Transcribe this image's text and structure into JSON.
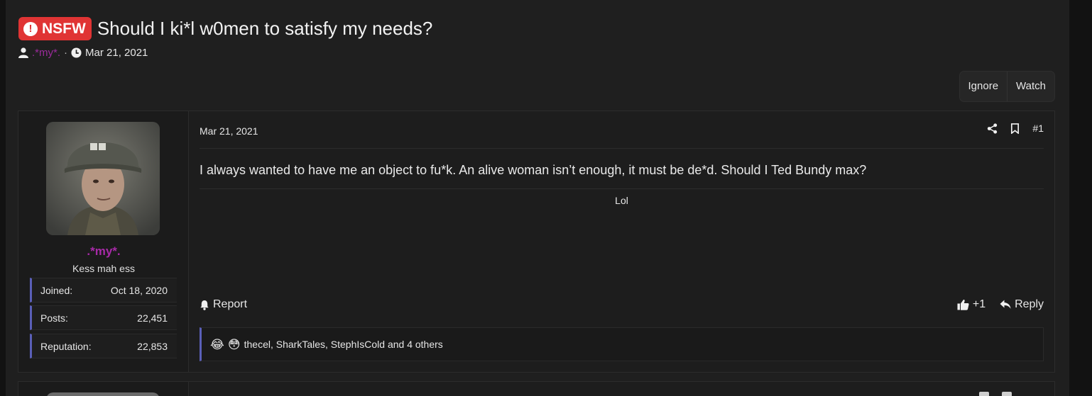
{
  "thread": {
    "badge_label": "NSFW",
    "badge_icon": "exclamation-circle-icon",
    "title": "Should I ki*l w0men to satisfy my needs?",
    "author": ".*my*.",
    "separator": "·",
    "date": "Mar 21, 2021"
  },
  "thread_buttons": {
    "ignore": "Ignore",
    "watch": "Watch"
  },
  "post": {
    "user": {
      "name": ".*my*.",
      "title": "Kess mah ess",
      "stats": [
        {
          "label": "Joined:",
          "value": "Oct 18, 2020"
        },
        {
          "label": "Posts:",
          "value": "22,451"
        },
        {
          "label": "Reputation:",
          "value": "22,853"
        }
      ]
    },
    "date": "Mar 21, 2021",
    "number": "#1",
    "body": "I always wanted to have me an object to fu*k. An alive woman isn’t enough, it must be de*d. Should I Ted Bundy max?",
    "signature": "Lol",
    "report_label": "Report",
    "like_count": "+1",
    "reply_label": "Reply",
    "reactions": {
      "emojis": [
        "😂",
        "😳"
      ],
      "text": "thecel, SharkTales, StephIsCold and 4 others"
    }
  },
  "colors": {
    "accent": "#5a5fb8",
    "nsfw": "#e03434",
    "username": "#a72aa7",
    "background": "#1f1f1f"
  }
}
